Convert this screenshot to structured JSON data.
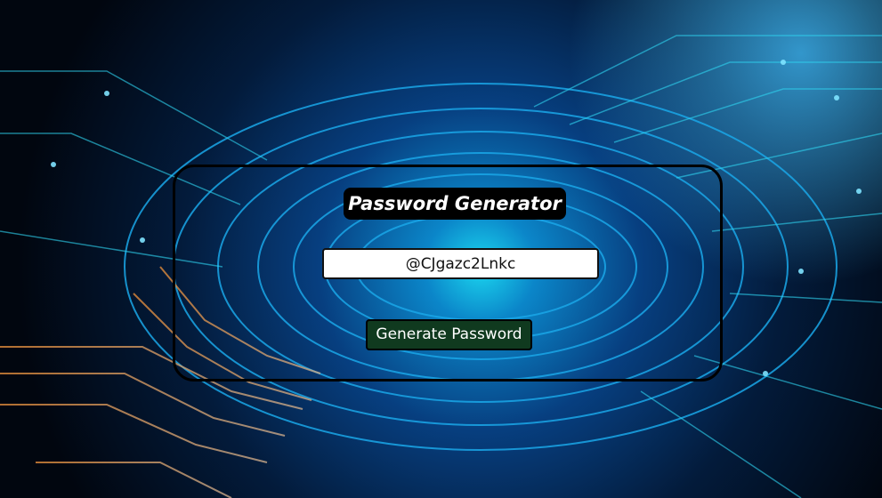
{
  "app": {
    "title": "Password Generator"
  },
  "password": {
    "value": "@CJgazc2Lnkc"
  },
  "actions": {
    "generate_label": "Generate Password"
  },
  "colors": {
    "background": "#020a18",
    "circuit_blue": "#1aa7e8",
    "circuit_cyan": "#2fd4f0",
    "circuit_orange": "#d88a3a",
    "button": "#103a1f",
    "title_box": "#000000"
  }
}
